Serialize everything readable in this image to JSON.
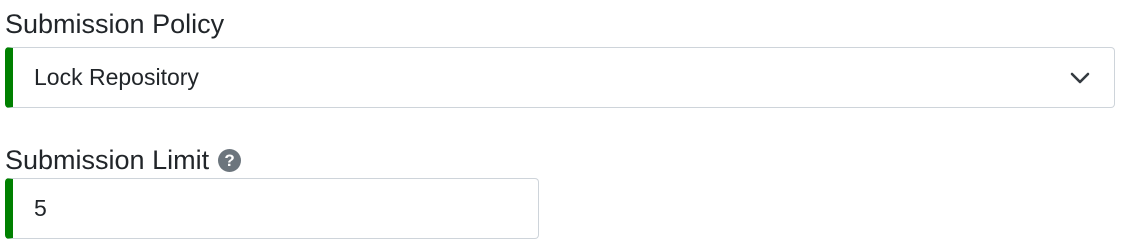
{
  "form": {
    "submission_policy": {
      "label": "Submission Policy",
      "selected_value": "Lock Repository",
      "icon": "chevron-down-icon"
    },
    "submission_limit": {
      "label": "Submission Limit",
      "help_icon": "question-circle-icon",
      "help_glyph": "?",
      "value": "5"
    }
  },
  "colors": {
    "valid_accent": "#008000",
    "border": "#ced4da",
    "text": "#212529",
    "help_icon": "#6c757d"
  }
}
